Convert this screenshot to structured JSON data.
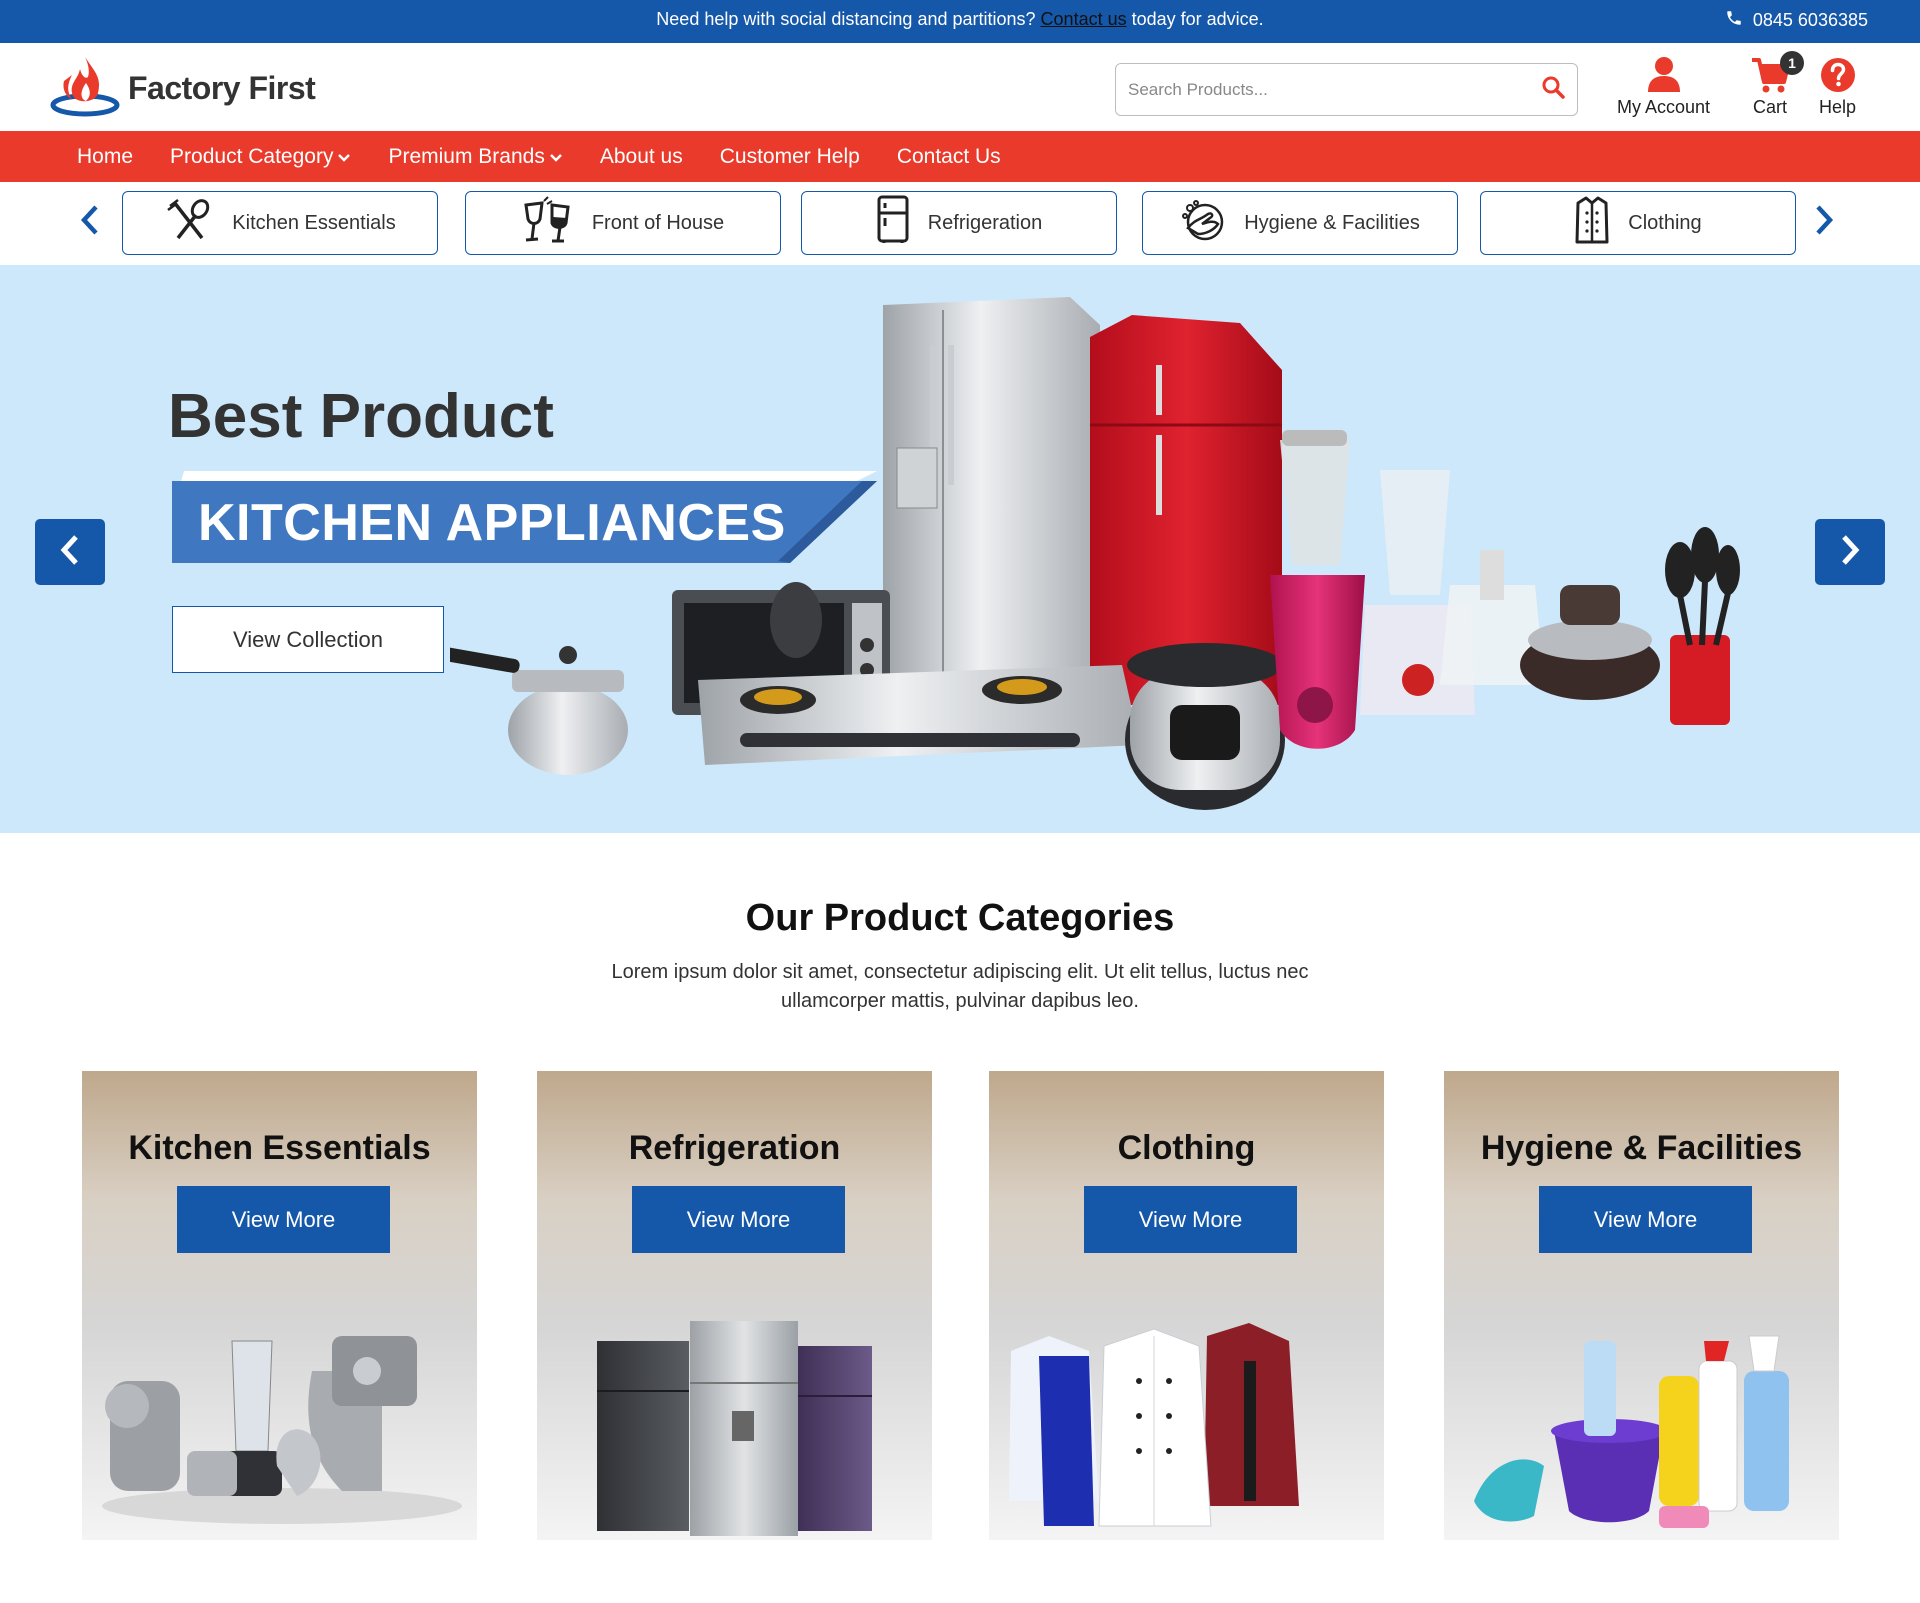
{
  "topbar": {
    "message_before": "Need help with social distancing and partitions?",
    "message_link": "Contact us",
    "message_after": "today for advice.",
    "phone": "0845 6036385"
  },
  "header": {
    "logo_text": "Factory First",
    "search_placeholder": "Search Products...",
    "actions": [
      {
        "label": "My Account",
        "icon": "user-icon"
      },
      {
        "label": "Cart",
        "icon": "cart-icon",
        "badge": "1"
      },
      {
        "label": "Help",
        "icon": "help-icon"
      }
    ]
  },
  "nav": {
    "items": [
      {
        "label": "Home"
      },
      {
        "label": "Product Category",
        "dropdown": true
      },
      {
        "label": "Premium Brands",
        "dropdown": true
      },
      {
        "label": "About us"
      },
      {
        "label": "Customer Help"
      },
      {
        "label": "Contact Us"
      }
    ]
  },
  "category_strip": {
    "items": [
      {
        "label": "Kitchen Essentials",
        "icon": "utensils-icon"
      },
      {
        "label": "Front of House",
        "icon": "wine-glasses-icon"
      },
      {
        "label": "Refrigeration",
        "icon": "fridge-icon"
      },
      {
        "label": "Hygiene & Facilities",
        "icon": "handwash-icon"
      },
      {
        "label": "Clothing",
        "icon": "chef-jacket-icon"
      }
    ]
  },
  "hero": {
    "title": "Best Product",
    "ribbon": "KITCHEN APPLIANCES",
    "button": "View Collection"
  },
  "categories_section": {
    "title": "Our Product Categories",
    "description": "Lorem ipsum dolor sit amet, consectetur adipiscing elit. Ut elit tellus, luctus nec ullamcorper mattis, pulvinar dapibus leo.",
    "cards": [
      {
        "title": "Kitchen Essentials",
        "button": "View More"
      },
      {
        "title": "Refrigeration",
        "button": "View More"
      },
      {
        "title": "Clothing",
        "button": "View More"
      },
      {
        "title": "Hygiene & Facilities",
        "button": "View More"
      }
    ]
  },
  "colors": {
    "brand_blue": "#1557a8",
    "brand_red": "#ea3a2b",
    "hero_bg": "#cde8fb"
  }
}
